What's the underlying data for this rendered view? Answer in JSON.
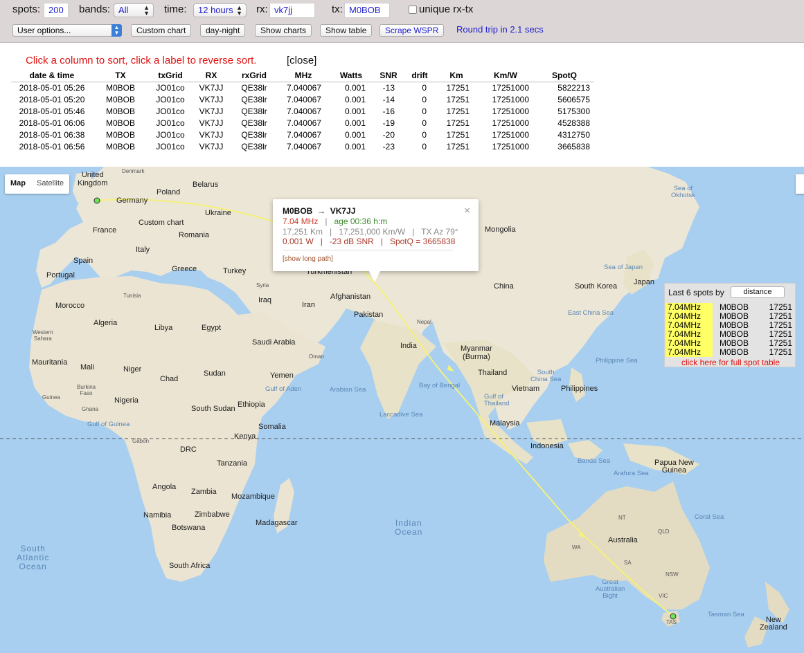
{
  "controls": {
    "spots_label": "spots:",
    "spots_value": "200",
    "bands_label": "bands:",
    "bands_value": "All",
    "time_label": "time:",
    "time_value": "12 hours",
    "rx_label": "rx:",
    "rx_value": "vk7jj",
    "tx_label": "tx:",
    "tx_value": "M0BOB",
    "unique_label": "unique rx-tx",
    "unique_checked": false,
    "user_options": "User options...",
    "custom_chart": "Custom chart",
    "day_night": "day-night",
    "show_charts": "Show charts",
    "show_table": "Show table",
    "scrape_wspr": "Scrape WSPR",
    "round_trip": "Round trip in 2.1 secs"
  },
  "results": {
    "hint": "Click a column to sort, click a label to reverse sort.",
    "close": "[close]",
    "headers": [
      "date & time",
      "TX",
      "txGrid",
      "RX",
      "rxGrid",
      "MHz",
      "Watts",
      "SNR",
      "drift",
      "Km",
      "Km/W",
      "SpotQ"
    ],
    "rows": [
      [
        "2018-05-01 05:26",
        "M0BOB",
        "JO01co",
        "VK7JJ",
        "QE38lr",
        "7.040067",
        "0.001",
        "-13",
        "0",
        "17251",
        "17251000",
        "5822213"
      ],
      [
        "2018-05-01 05:20",
        "M0BOB",
        "JO01co",
        "VK7JJ",
        "QE38lr",
        "7.040067",
        "0.001",
        "-14",
        "0",
        "17251",
        "17251000",
        "5606575"
      ],
      [
        "2018-05-01 05:46",
        "M0BOB",
        "JO01co",
        "VK7JJ",
        "QE38lr",
        "7.040067",
        "0.001",
        "-16",
        "0",
        "17251",
        "17251000",
        "5175300"
      ],
      [
        "2018-05-01 06:06",
        "M0BOB",
        "JO01co",
        "VK7JJ",
        "QE38lr",
        "7.040067",
        "0.001",
        "-19",
        "0",
        "17251",
        "17251000",
        "4528388"
      ],
      [
        "2018-05-01 06:38",
        "M0BOB",
        "JO01co",
        "VK7JJ",
        "QE38lr",
        "7.040067",
        "0.001",
        "-20",
        "0",
        "17251",
        "17251000",
        "4312750"
      ],
      [
        "2018-05-01 06:56",
        "M0BOB",
        "JO01co",
        "VK7JJ",
        "QE38lr",
        "7.040067",
        "0.001",
        "-23",
        "0",
        "17251",
        "17251000",
        "3665838"
      ]
    ]
  },
  "map": {
    "map_btn": "Map",
    "satellite_btn": "Satellite",
    "labels": {
      "uk": "United\nKingdom",
      "denmark": "Denmark",
      "belarus": "Belarus",
      "poland": "Poland",
      "germany": "Germany",
      "ukraine": "Ukraine",
      "france": "France",
      "custom_chart_map": "Custom chart",
      "romania": "Romania",
      "italy": "Italy",
      "spain": "Spain",
      "portugal": "Portugal",
      "greece": "Greece",
      "turkey": "Turkey",
      "tunisia": "Tunisia",
      "morocco": "Morocco",
      "algeria": "Algeria",
      "libya": "Libya",
      "egypt": "Egypt",
      "western_sahara": "Western\nSahara",
      "mauritania": "Mauritania",
      "mali": "Mali",
      "niger": "Niger",
      "chad": "Chad",
      "sudan": "Sudan",
      "burkina": "Burkina\nFaso",
      "guinea": "Guinea",
      "ghana": "Ghana",
      "nigeria": "Nigeria",
      "south_sudan": "South Sudan",
      "ethiopia": "Ethiopia",
      "gulf_guinea": "Gulf of Guinea",
      "gabon": "Gabon",
      "drc": "DRC",
      "kenya": "Kenya",
      "somalia": "Somalia",
      "tanzania": "Tanzania",
      "angola": "Angola",
      "zambia": "Zambia",
      "mozambique": "Mozambique",
      "namibia": "Namibia",
      "zimbabwe": "Zimbabwe",
      "botswana": "Botswana",
      "madagascar": "Madagascar",
      "south_africa": "South Africa",
      "south_atlantic": "South\nAtlantic\nOcean",
      "indian_ocean": "Indian\nOcean",
      "iraq": "Iraq",
      "iran": "Iran",
      "syria": "Syria",
      "saudi": "Saudi Arabia",
      "oman": "Oman",
      "yemen": "Yemen",
      "gulf_aden": "Gulf of Aden",
      "arabian_sea": "Arabian Sea",
      "afghanistan": "Afghanistan",
      "pakistan": "Pakistan",
      "turkmenistan": "Turkmenistan",
      "india": "India",
      "nepal": "Nepal",
      "bay_bengal": "Bay of Bengal",
      "laccadive": "Laccadive Sea",
      "myanmar": "Myanmar\n(Burma)",
      "thailand": "Thailand",
      "vietnam": "Vietnam",
      "gulf_thailand": "Gulf of\nThailand",
      "malaysia": "Malaysia",
      "mongolia": "Mongolia",
      "china": "China",
      "south_korea": "South Korea",
      "japan": "Japan",
      "sea_japan": "Sea of Japan",
      "sea_okhotsk": "Sea of\nOkhotsk",
      "east_china_sea": "East China Sea",
      "philippines": "Philippines",
      "philippine_sea": "Philippine Sea",
      "south_china_sea": "South\nChina Sea",
      "indonesia": "Indonesia",
      "banda_sea": "Banda Sea",
      "arafura_sea": "Arafura Sea",
      "png": "Papua New\nGuinea",
      "australia": "Australia",
      "nt": "NT",
      "qld": "QLD",
      "wa": "WA",
      "sa": "SA",
      "nsw": "NSW",
      "vic": "VIC",
      "tas": "TAS",
      "coral_sea": "Coral Sea",
      "tasman_sea": "Tasman Sea",
      "great_bight": "Great\nAustralian\nBight",
      "new_zealand": "New\nZealand"
    }
  },
  "infowindow": {
    "title_from": "M0BOB",
    "arrow": "→",
    "title_to": "VK7JJ",
    "freq": "7.04 MHz",
    "sep": "|",
    "age": "age 00:36 h:m",
    "row3": "17,251 Km   |   17,251,000 Km/W   |   TX Az 79°",
    "row4": "0.001 W   |   -23 dB SNR   |   SpotQ = 3665838",
    "long_path": "[show long path]",
    "close": "×"
  },
  "last_spots": {
    "header": "Last 6 spots by",
    "sort_value": "distance",
    "rows": [
      {
        "freq": "7.04MHz",
        "call": "M0BOB",
        "km": "17251"
      },
      {
        "freq": "7.04MHz",
        "call": "M0BOB",
        "km": "17251"
      },
      {
        "freq": "7.04MHz",
        "call": "M0BOB",
        "km": "17251"
      },
      {
        "freq": "7.04MHz",
        "call": "M0BOB",
        "km": "17251"
      },
      {
        "freq": "7.04MHz",
        "call": "M0BOB",
        "km": "17251"
      },
      {
        "freq": "7.04MHz",
        "call": "M0BOB",
        "km": "17251"
      }
    ],
    "full_table": "click here for full spot table"
  },
  "colors": {
    "path_line": "#f4f07a",
    "marker": "#6ee05a",
    "highlight": "#ffff66",
    "link_blue": "#1f1fcf",
    "hint_red": "#e01010"
  }
}
